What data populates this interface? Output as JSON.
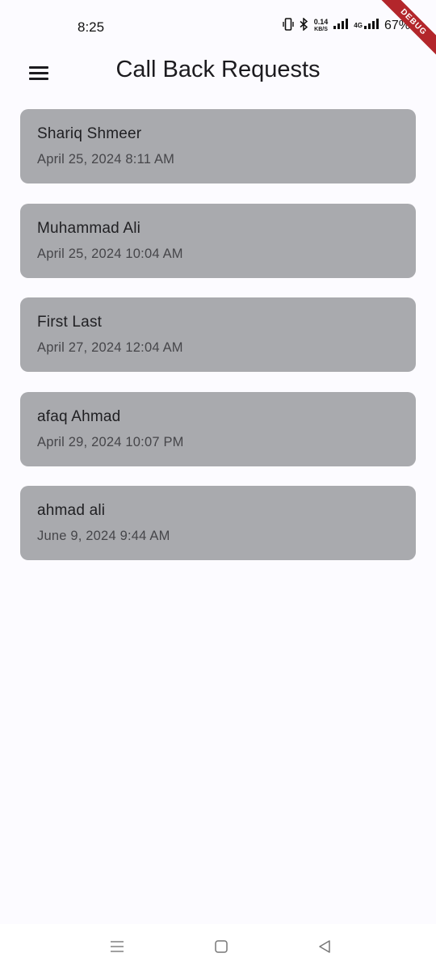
{
  "status_bar": {
    "time": "8:25",
    "net_speed_value": "0.14",
    "net_speed_unit": "KB/S",
    "signal_label": "4G",
    "battery": "67%"
  },
  "debug_banner": "DEBUG",
  "app_bar": {
    "title": "Call Back Requests",
    "menu_icon": "hamburger-menu-icon"
  },
  "requests": [
    {
      "name": "Shariq Shmeer",
      "date": "April 25, 2024 8:11 AM"
    },
    {
      "name": "Muhammad Ali",
      "date": "April 25, 2024 10:04 AM"
    },
    {
      "name": "First Last",
      "date": "April 27, 2024 12:04 AM"
    },
    {
      "name": "afaq Ahmad",
      "date": "April 29, 2024 10:07 PM"
    },
    {
      "name": "ahmad ali",
      "date": "June 9, 2024 9:44 AM"
    }
  ],
  "nav_bar": {
    "icons": [
      "recent-apps-icon",
      "home-icon",
      "back-icon"
    ]
  },
  "colors": {
    "background": "#fcfbff",
    "card": "#a9aaae",
    "debug_ribbon": "#b3262b"
  }
}
